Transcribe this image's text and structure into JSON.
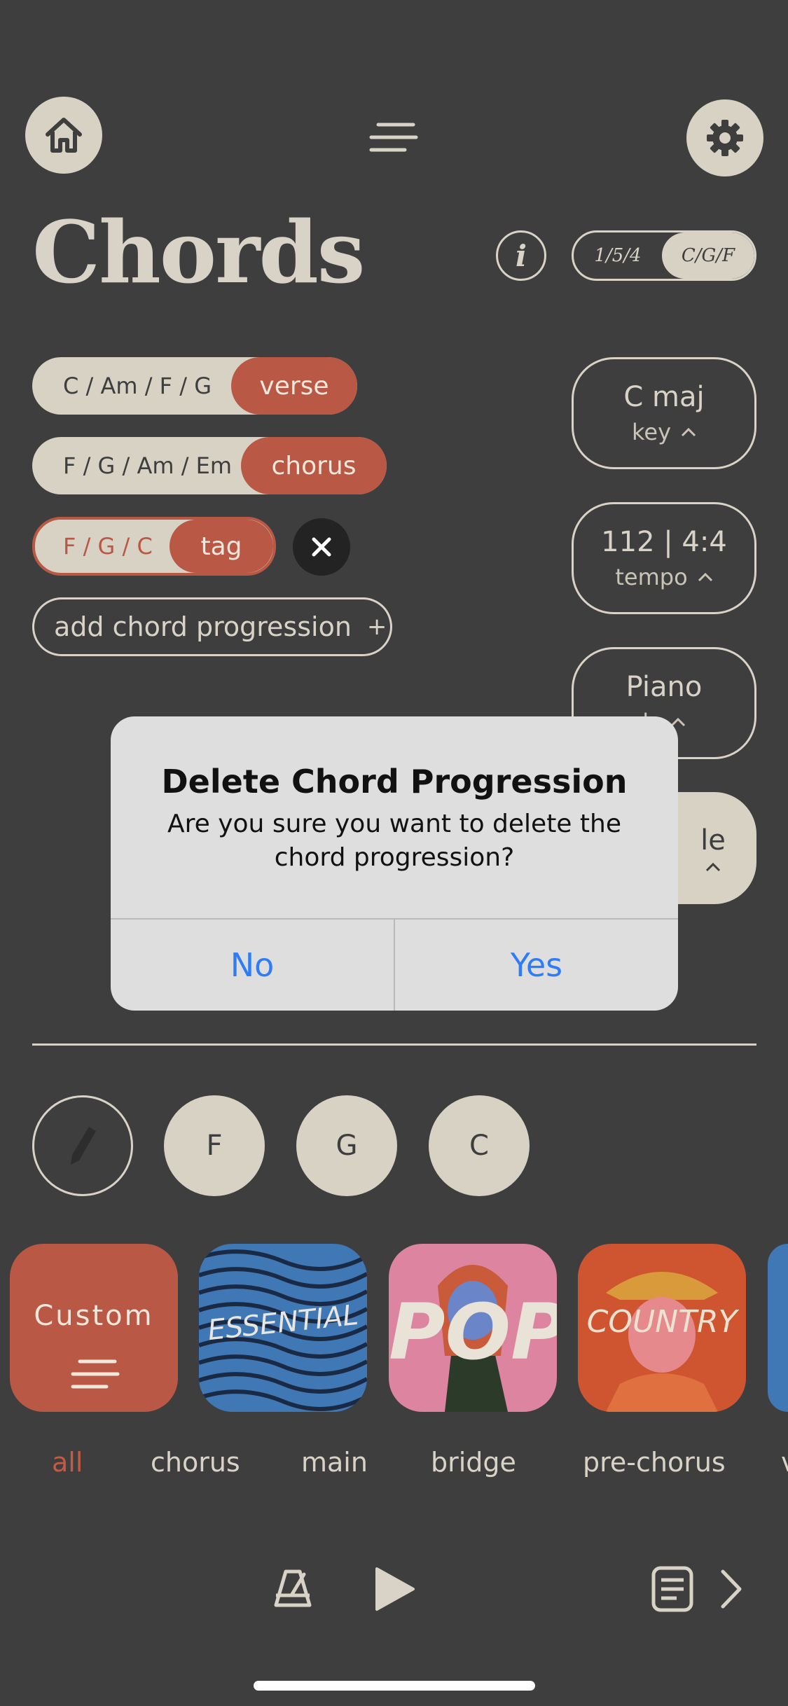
{
  "header": {
    "title": "Chords",
    "info_label": "i",
    "toggle": {
      "option1": "1/5/4",
      "option2": "C/G/F",
      "selected": "C/G/F"
    }
  },
  "progressions": [
    {
      "chords": "C / Am / F / G",
      "tag": "verse"
    },
    {
      "chords": "F / G / Am / Em",
      "tag": "chorus"
    },
    {
      "chords": "F / G / C",
      "tag": "tag"
    }
  ],
  "add_progression_label": "add chord progression",
  "add_icon": "+",
  "close_icon": "×",
  "side": {
    "key_main": "C maj",
    "key_sub": "key",
    "tempo_main": "112 | 4:4",
    "tempo_sub": "tempo",
    "instrument_main": "Piano",
    "instrument_sub": "ls",
    "style_main": "le"
  },
  "chord_buttons": [
    "F",
    "G",
    "C"
  ],
  "packs": [
    {
      "label": "Custom",
      "color": "#b95845"
    },
    {
      "label": "ESSENTIAL",
      "color": "#3f78b5"
    },
    {
      "label": "POP",
      "color": "#dc84a0"
    },
    {
      "label": "COUNTRY",
      "color": "#cf5530"
    }
  ],
  "categories": [
    "all",
    "chorus",
    "main",
    "bridge",
    "pre-chorus",
    "v"
  ],
  "alert": {
    "title": "Delete Chord Progression",
    "message": "Are you sure you want to delete the chord progression?",
    "no_label": "No",
    "yes_label": "Yes"
  },
  "colors": {
    "background": "#3e3e3e",
    "cream": "#d7d2c4",
    "accent": "#b95845",
    "link_blue": "#2f7cf6"
  }
}
